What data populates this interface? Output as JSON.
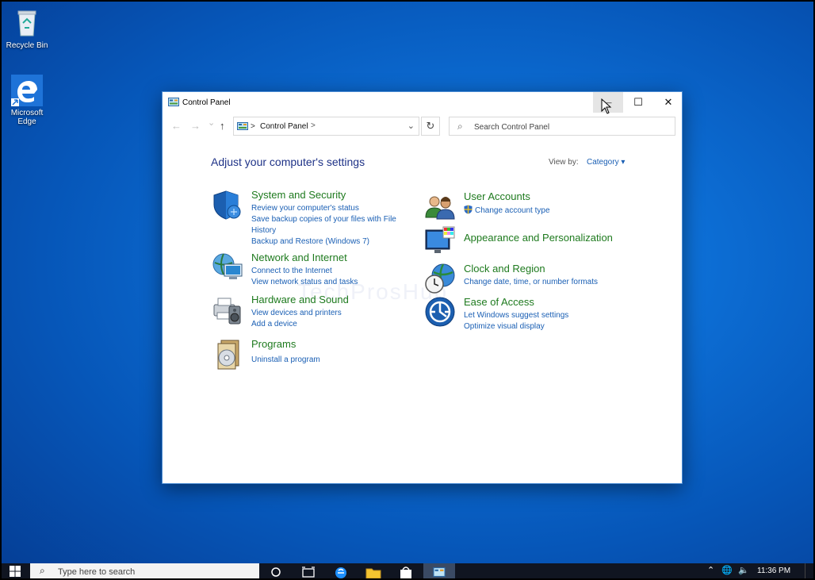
{
  "desktop": {
    "icons": [
      {
        "label": "Recycle Bin"
      },
      {
        "label": "Microsoft Edge"
      }
    ]
  },
  "window": {
    "title": "Control Panel",
    "controls": {
      "minimize": "—",
      "maximize": "☐",
      "close": "✕"
    }
  },
  "nav": {
    "back": "←",
    "forward": "→",
    "recent": "⌄",
    "up": "↑",
    "address_sep1": ">",
    "address_crumb": "Control Panel",
    "address_sep2": ">",
    "address_dropdown": "⌄",
    "refresh": "↻",
    "search_icon": "⌕",
    "search_placeholder": "Search Control Panel"
  },
  "main": {
    "heading": "Adjust your computer's settings",
    "view_by_label": "View by:",
    "view_by_value": "Category ▾",
    "left_categories": [
      {
        "title": "System and Security",
        "icon": "shield-icon",
        "links": [
          "Review your computer's status",
          "Save backup copies of your files with File History",
          "Backup and Restore (Windows 7)"
        ]
      },
      {
        "title": "Network and Internet",
        "icon": "network-globe-icon",
        "links": [
          "Connect to the Internet",
          "View network status and tasks"
        ]
      },
      {
        "title": "Hardware and Sound",
        "icon": "printer-speaker-icon",
        "links": [
          "View devices and printers",
          "Add a device"
        ]
      },
      {
        "title": "Programs",
        "icon": "programs-disc-icon",
        "links": [
          "Uninstall a program"
        ]
      }
    ],
    "right_categories": [
      {
        "title": "User Accounts",
        "icon": "users-icon",
        "links": [
          "Change account type"
        ]
      },
      {
        "title": "Appearance and Personalization",
        "icon": "monitor-palette-icon",
        "links": []
      },
      {
        "title": "Clock and Region",
        "icon": "clock-globe-icon",
        "links": [
          "Change date, time, or number formats"
        ]
      },
      {
        "title": "Ease of Access",
        "icon": "accessibility-icon",
        "links": [
          "Let Windows suggest settings",
          "Optimize visual display"
        ]
      }
    ]
  },
  "taskbar": {
    "search_placeholder": "Type here to search",
    "clock_time": "11:36 PM"
  }
}
